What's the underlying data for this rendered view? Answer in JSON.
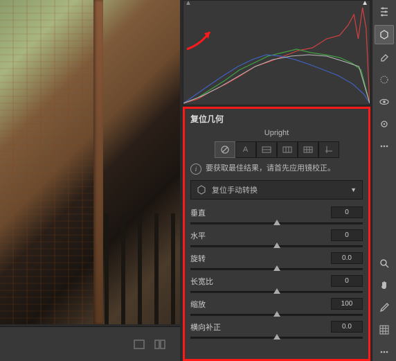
{
  "panel": {
    "title": "复位几何",
    "upright_label": "Upright",
    "upright_modes": [
      "⊘",
      "A",
      "▭",
      "▯▯",
      "▦",
      "⧈"
    ],
    "info_text": "要获取最佳结果，请首先应用镜校正。",
    "reset_label": "复位手动转换",
    "sliders": [
      {
        "label": "垂直",
        "value": "0",
        "pos": 50
      },
      {
        "label": "水平",
        "value": "0",
        "pos": 50
      },
      {
        "label": "旋转",
        "value": "0.0",
        "pos": 50
      },
      {
        "label": "长宽比",
        "value": "0",
        "pos": 50
      },
      {
        "label": "缩放",
        "value": "100",
        "pos": 50
      },
      {
        "label": "横向补正",
        "value": "0.0",
        "pos": 50
      }
    ]
  },
  "toolbar_icons": [
    "sliders-icon",
    "transform-icon",
    "eraser-icon",
    "radial-icon",
    "eye-icon",
    "brush-icon",
    "dots-icon"
  ],
  "toolbar_icons_bottom": [
    "zoom-icon",
    "hand-icon",
    "eyedropper-icon",
    "grid-icon",
    "more-icon"
  ]
}
